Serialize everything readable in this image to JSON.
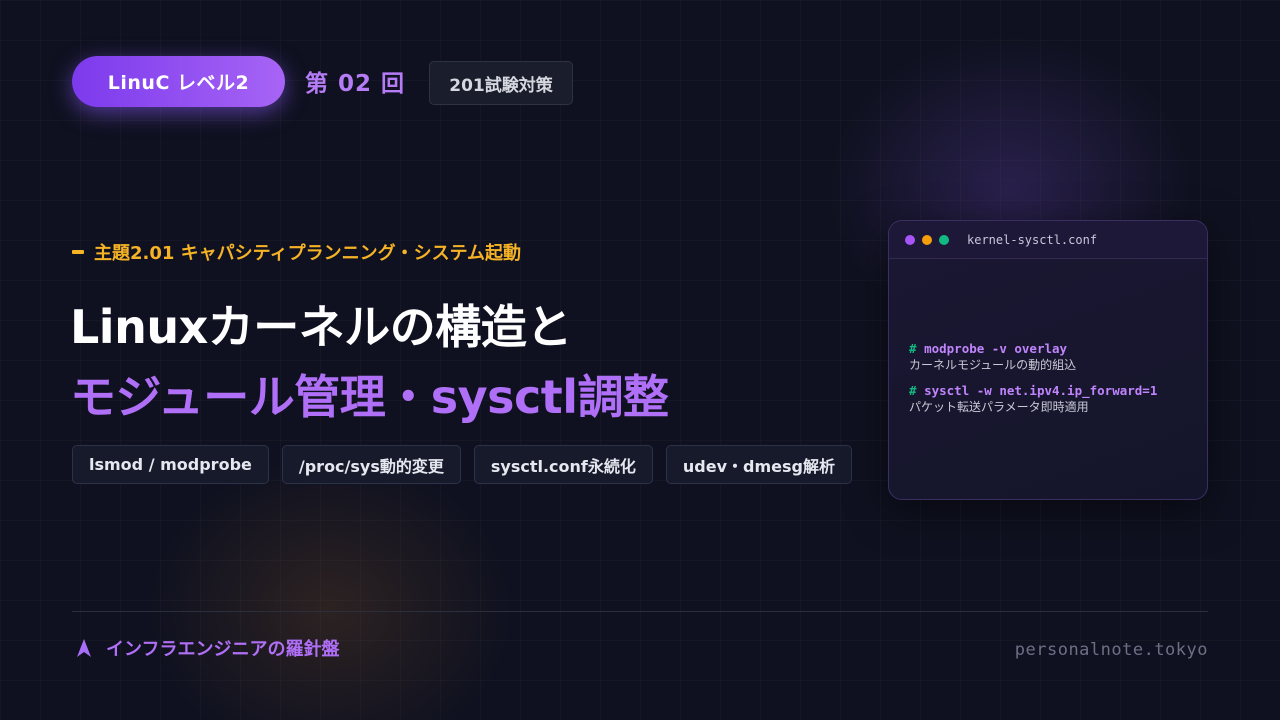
{
  "header": {
    "level_badge": "LinuC レベル2",
    "episode": "第 02 回",
    "exam_tag": "201試験対策"
  },
  "topic": "主題2.01 キャパシティプランニング・システム起動",
  "title": {
    "line1": "Linuxカーネルの構造と",
    "line2": "モジュール管理・sysctl調整"
  },
  "tags": [
    "lsmod / modprobe",
    "/proc/sys動的変更",
    "sysctl.conf永続化",
    "udev・dmesg解析"
  ],
  "terminal": {
    "filename": "kernel-sysctl.conf",
    "lines": [
      {
        "prompt": "#",
        "command": "modprobe -v overlay",
        "description": "カーネルモジュールの動的組込"
      },
      {
        "prompt": "#",
        "command": "sysctl -w net.ipv4.ip_forward=1",
        "description": "パケット転送パラメータ即時適用"
      }
    ]
  },
  "footer": {
    "brand": "インフラエンジニアの羅針盤",
    "site": "personalnote.tokyo"
  },
  "colors": {
    "accent_purple": "#b06ff7",
    "accent_orange": "#f5b325",
    "prompt_green": "#10b981",
    "background": "#0f1120"
  },
  "icons": {
    "brand_icon": "compass-arrow-icon",
    "window_dots": [
      "purple-dot",
      "orange-dot",
      "green-dot"
    ]
  }
}
